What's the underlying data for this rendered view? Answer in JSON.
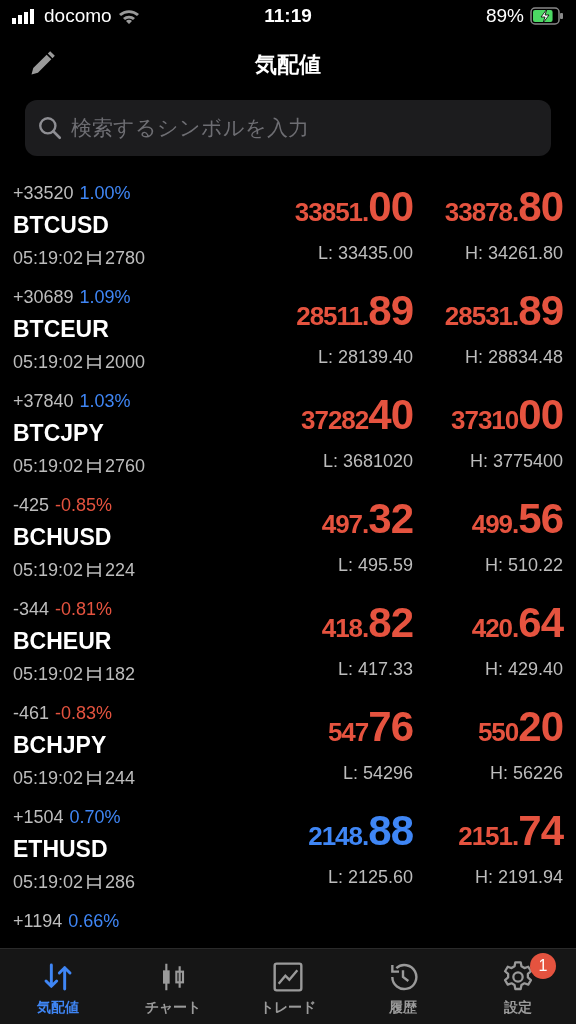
{
  "status_bar": {
    "carrier": "docomo",
    "time": "11:19",
    "battery": "89%",
    "charging": true
  },
  "header": {
    "title": "気配値"
  },
  "search": {
    "placeholder": "検索するシンボルを入力"
  },
  "quotes": [
    {
      "change": "+33520",
      "percent": "1.00%",
      "color": "#3f86f5",
      "symbol": "BTCUSD",
      "time": "05:19:02",
      "spread": "2780",
      "bid": {
        "small": "33851.",
        "big": "00",
        "color": "#e5533f"
      },
      "ask": {
        "small": "33878.",
        "big": "80",
        "color": "#e5533f"
      },
      "low": "L: 33435.00",
      "high": "H: 34261.80"
    },
    {
      "change": "+30689",
      "percent": "1.09%",
      "color": "#3f86f5",
      "symbol": "BTCEUR",
      "time": "05:19:02",
      "spread": "2000",
      "bid": {
        "small": "28511.",
        "big": "89",
        "color": "#e5533f"
      },
      "ask": {
        "small": "28531.",
        "big": "89",
        "color": "#e5533f"
      },
      "low": "L: 28139.40",
      "high": "H: 28834.48"
    },
    {
      "change": "+37840",
      "percent": "1.03%",
      "color": "#3f86f5",
      "symbol": "BTCJPY",
      "time": "05:19:02",
      "spread": "2760",
      "bid": {
        "small": "37282",
        "big": "40",
        "color": "#e5533f"
      },
      "ask": {
        "small": "37310",
        "big": "00",
        "color": "#e5533f"
      },
      "low": "L: 3681020",
      "high": "H: 3775400"
    },
    {
      "change": "-425",
      "percent": "-0.85%",
      "color": "#e5533f",
      "symbol": "BCHUSD",
      "time": "05:19:02",
      "spread": "224",
      "bid": {
        "small": "497.",
        "big": "32",
        "color": "#e5533f"
      },
      "ask": {
        "small": "499.",
        "big": "56",
        "color": "#e5533f"
      },
      "low": "L: 495.59",
      "high": "H: 510.22"
    },
    {
      "change": "-344",
      "percent": "-0.81%",
      "color": "#e5533f",
      "symbol": "BCHEUR",
      "time": "05:19:02",
      "spread": "182",
      "bid": {
        "small": "418.",
        "big": "82",
        "color": "#e5533f"
      },
      "ask": {
        "small": "420.",
        "big": "64",
        "color": "#e5533f"
      },
      "low": "L: 417.33",
      "high": "H: 429.40"
    },
    {
      "change": "-461",
      "percent": "-0.83%",
      "color": "#e5533f",
      "symbol": "BCHJPY",
      "time": "05:19:02",
      "spread": "244",
      "bid": {
        "small": "547",
        "big": "76",
        "color": "#e5533f"
      },
      "ask": {
        "small": "550",
        "big": "20",
        "color": "#e5533f"
      },
      "low": "L: 54296",
      "high": "H: 56226"
    },
    {
      "change": "+1504",
      "percent": "0.70%",
      "color": "#3f86f5",
      "symbol": "ETHUSD",
      "time": "05:19:02",
      "spread": "286",
      "bid": {
        "small": "2148.",
        "big": "88",
        "color": "#3f86f5"
      },
      "ask": {
        "small": "2151.",
        "big": "74",
        "color": "#e5533f"
      },
      "low": "L: 2125.60",
      "high": "H: 2191.94"
    },
    {
      "change": "+1194",
      "percent": "0.66%",
      "color": "#3f86f5"
    }
  ],
  "tabs": [
    {
      "kind": "quotes",
      "label": "気配値",
      "selected": true
    },
    {
      "kind": "chart",
      "label": "チャート",
      "selected": false
    },
    {
      "kind": "trade",
      "label": "トレード",
      "selected": false
    },
    {
      "kind": "history",
      "label": "履歴",
      "selected": false
    },
    {
      "kind": "settings",
      "label": "設定",
      "selected": false,
      "badge": "1"
    }
  ]
}
